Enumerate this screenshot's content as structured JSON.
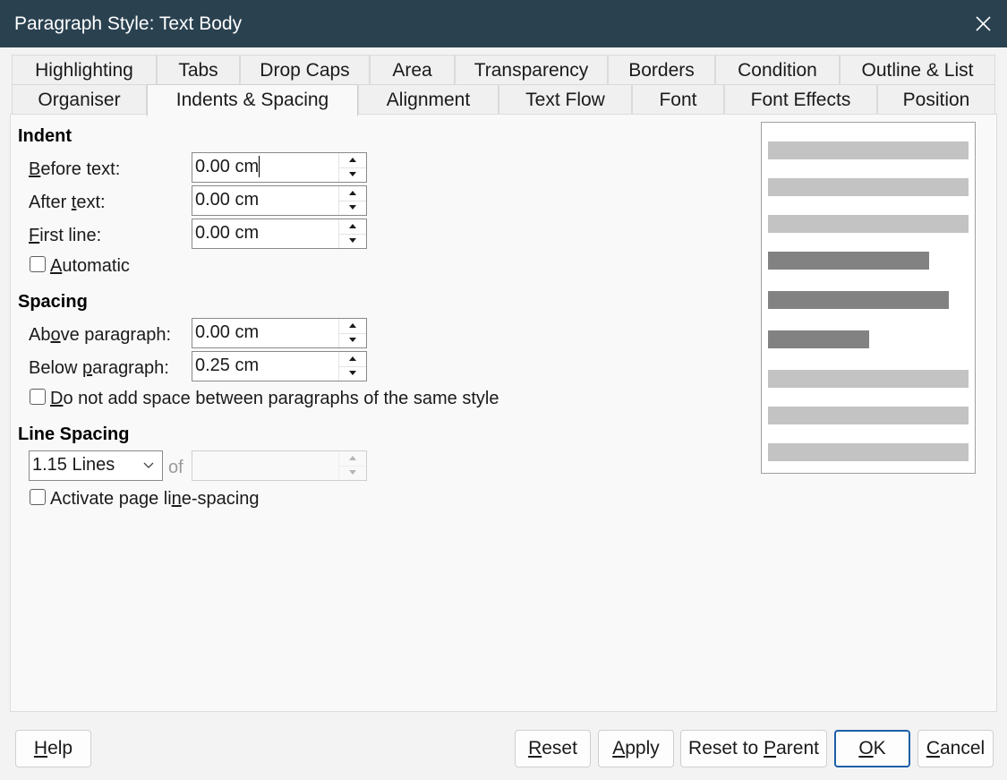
{
  "window": {
    "title": "Paragraph Style: Text Body"
  },
  "tabs_row1": [
    "Highlighting",
    "Tabs",
    "Drop Caps",
    "Area",
    "Transparency",
    "Borders",
    "Condition",
    "Outline & List"
  ],
  "tabs_row2": [
    "Organiser",
    "Indents & Spacing",
    "Alignment",
    "Text Flow",
    "Font",
    "Font Effects",
    "Position"
  ],
  "active_tab": "Indents & Spacing",
  "indent": {
    "title": "Indent",
    "before_text": {
      "label_pre": "",
      "label_u": "B",
      "label_post": "efore text:",
      "value": "0.00 cm"
    },
    "after_text": {
      "label_pre": "After ",
      "label_u": "t",
      "label_post": "ext:",
      "value": "0.00 cm"
    },
    "first_line": {
      "label_pre": "",
      "label_u": "F",
      "label_post": "irst line:",
      "value": "0.00 cm"
    },
    "automatic": {
      "label_pre": "",
      "label_u": "A",
      "label_post": "utomatic",
      "checked": false
    }
  },
  "spacing": {
    "title": "Spacing",
    "above": {
      "label_pre": "Ab",
      "label_u": "o",
      "label_post": "ve paragraph:",
      "value": "0.00 cm"
    },
    "below": {
      "label_pre": "Below ",
      "label_u": "p",
      "label_post": "aragraph:",
      "value": "0.25 cm"
    },
    "no_space": {
      "label_pre": "",
      "label_u": "D",
      "label_post": "o not add space between paragraphs of the same style",
      "checked": false
    }
  },
  "line_spacing": {
    "title": "Line Spacing",
    "mode": "1.15 Lines",
    "of_label": "of",
    "of_value": "",
    "page_line_spacing": {
      "label_pre": "Activate page li",
      "label_u": "n",
      "label_post": "e-spacing",
      "checked": false
    }
  },
  "preview": {
    "light_color": "#c3c3c3",
    "dark_color": "#828282"
  },
  "buttons": {
    "help": {
      "pre": "",
      "u": "H",
      "post": "elp"
    },
    "reset": {
      "pre": "",
      "u": "R",
      "post": "eset"
    },
    "apply": {
      "pre": "",
      "u": "A",
      "post": "pply"
    },
    "reset_parent": {
      "pre": "Reset to ",
      "u": "P",
      "post": "arent"
    },
    "ok": {
      "pre": "",
      "u": "O",
      "post": "K"
    },
    "cancel": {
      "pre": "",
      "u": "C",
      "post": "ancel"
    }
  },
  "colors": {
    "titlebar": "#2a4150",
    "primary_border": "#1a5fa8"
  }
}
